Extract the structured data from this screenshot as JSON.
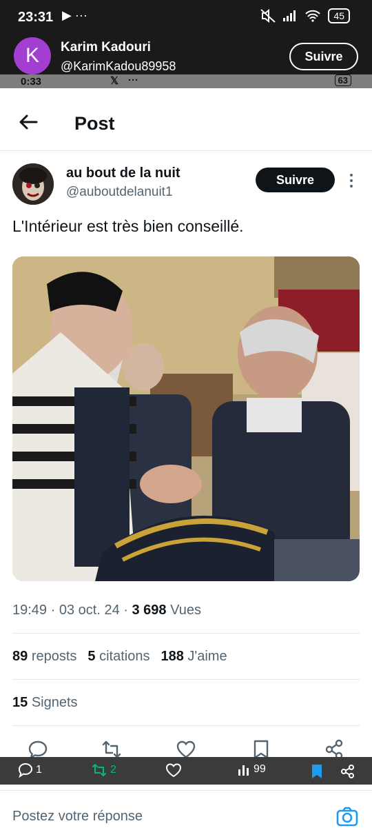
{
  "status_bar": {
    "time": "23:31",
    "left_icons": "▶ ···",
    "battery": "45"
  },
  "outer_header": {
    "avatar_letter": "K",
    "name": "Karim Kadouri",
    "handle": "@KarimKadou89958",
    "follow_label": "Suivre"
  },
  "inner_status": {
    "time": "0:33",
    "x_icon": "𝕏",
    "dots": "···",
    "battery": "63"
  },
  "post_header": {
    "title": "Post"
  },
  "author": {
    "name": "au bout de la nuit",
    "handle": "@auboutdelanuit1",
    "follow_label": "Suivre"
  },
  "tweet": {
    "text": "L'Intérieur est très bien conseillé."
  },
  "meta": {
    "time": "19:49",
    "sep1": " · ",
    "date": "03 oct. 24",
    "sep2": " · ",
    "views_count": "3 698",
    "views_label": "Vues"
  },
  "stats": {
    "reposts_count": "89",
    "reposts_label": "reposts",
    "quotes_count": "5",
    "quotes_label": "citations",
    "likes_count": "188",
    "likes_label": "J'aime"
  },
  "bookmarks": {
    "count": "15",
    "label": "Signets"
  },
  "bottom_overlay": {
    "replies": "1",
    "reposts": "2",
    "views": "99"
  },
  "reply_bar": {
    "placeholder": "Postez votre réponse"
  },
  "colors": {
    "follow_dark": "#0f1419",
    "secondary_text": "#536471",
    "repost_green": "#00ba7c",
    "accent_blue": "#1d9bf0",
    "outer_avatar": "#a23fd0"
  },
  "icons": [
    "back-arrow-icon",
    "more-icon",
    "reply-icon",
    "repost-icon",
    "like-icon",
    "bookmark-icon",
    "share-icon",
    "camera-icon",
    "views-icon"
  ]
}
